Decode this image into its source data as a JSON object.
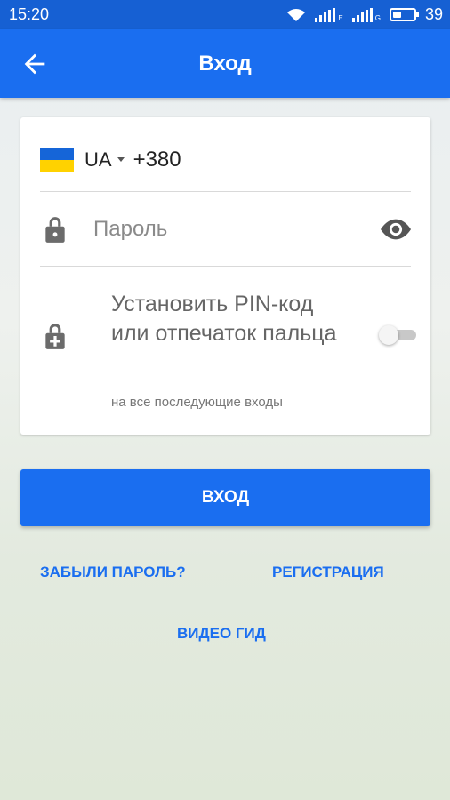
{
  "status_bar": {
    "time": "15:20",
    "sim1_label": "E",
    "sim2_label": "G",
    "battery": "39",
    "battery_level": 0.39
  },
  "app_bar": {
    "title": "Вход",
    "back_icon": "arrow-back-icon",
    "color": "#1a6ef0"
  },
  "form": {
    "country_code": "UA",
    "phone_value": "+380",
    "password_placeholder": "Пароль",
    "pin_label": "Установить PIN-код или отпечаток пальца",
    "pin_sublabel": "на все последующие входы",
    "pin_enabled": false
  },
  "actions": {
    "login_label": "ВХОД",
    "forgot_label": "ЗАБЫЛИ ПАРОЛЬ?",
    "register_label": "РЕГИСТРАЦИЯ",
    "video_guide_label": "ВИДЕО ГИД"
  },
  "colors": {
    "accent": "#1a6ef0",
    "status_bar": "#1660d3",
    "flag_blue": "#1565d8",
    "flag_yellow": "#ffd200"
  }
}
